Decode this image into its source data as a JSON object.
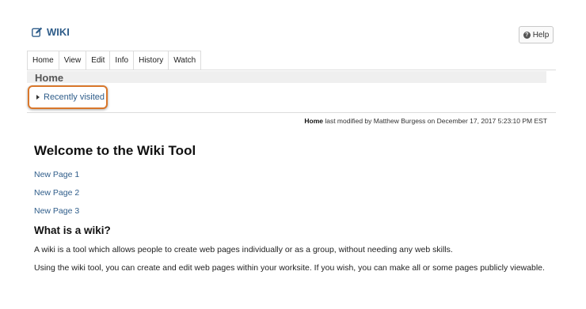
{
  "tool": {
    "title": "WIKI",
    "icon": "edit-icon",
    "accent_color": "#2f5d8a"
  },
  "help": {
    "label": "Help",
    "icon": "question-circle-icon"
  },
  "tabs": [
    {
      "label": "Home"
    },
    {
      "label": "View"
    },
    {
      "label": "Edit"
    },
    {
      "label": "Info"
    },
    {
      "label": "History"
    },
    {
      "label": "Watch"
    }
  ],
  "page": {
    "heading": "Home",
    "recently_visited": "Recently visited",
    "highlight_color": "#d9772b",
    "modified": {
      "page_name": "Home",
      "text": " last modified by Matthew Burgess on December 17, 2017 5:23:10 PM EST"
    }
  },
  "content": {
    "title": "Welcome to the Wiki Tool",
    "links": [
      "New Page 1",
      "New Page 2",
      "New Page 3"
    ],
    "subtitle": "What is a wiki?",
    "paragraphs": [
      "A wiki is a tool which allows people to create web pages individually or as a group, without needing any web skills.",
      "Using the wiki tool, you can create and edit web pages within your worksite. If you wish, you can make all or some pages publicly viewable."
    ]
  }
}
